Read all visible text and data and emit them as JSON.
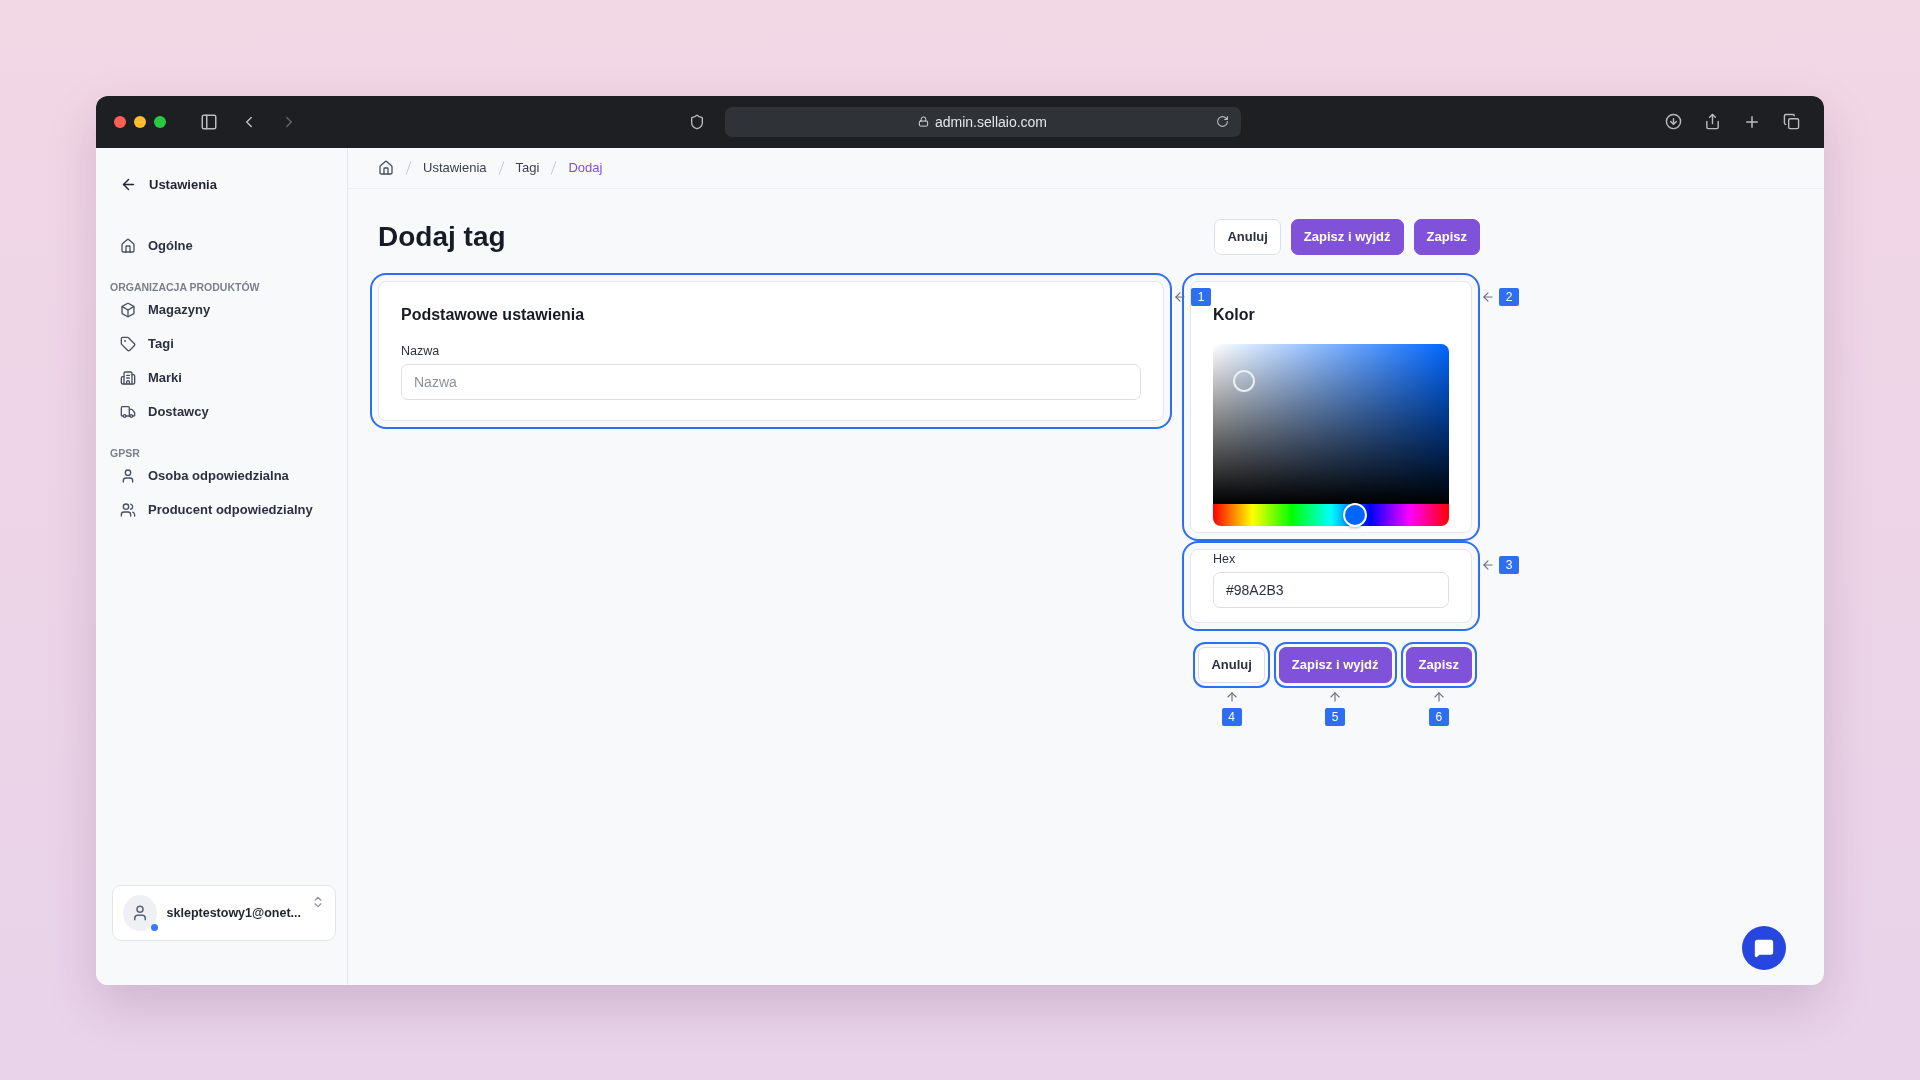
{
  "browser": {
    "url": "admin.sellaio.com"
  },
  "sidebar": {
    "back_label": "Ustawienia",
    "top_items": [
      {
        "label": "Ogólne"
      }
    ],
    "sections": [
      {
        "heading": "ORGANIZACJA PRODUKTÓW",
        "items": [
          {
            "label": "Magazyny"
          },
          {
            "label": "Tagi"
          },
          {
            "label": "Marki"
          },
          {
            "label": "Dostawcy"
          }
        ]
      },
      {
        "heading": "GPSR",
        "items": [
          {
            "label": "Osoba odpowiedzialna"
          },
          {
            "label": "Producent odpowiedzialny"
          }
        ]
      }
    ],
    "user": {
      "email": "skleptestowy1@onet...",
      "online": true
    }
  },
  "breadcrumb": [
    {
      "label": "Ustawienia",
      "selected": false
    },
    {
      "label": "Tagi",
      "selected": false
    },
    {
      "label": "Dodaj",
      "selected": true
    }
  ],
  "page": {
    "title": "Dodaj tag",
    "buttons": [
      {
        "label": "Anuluj",
        "kind": "secondary"
      },
      {
        "label": "Zapisz i wyjdź",
        "kind": "primary"
      },
      {
        "label": "Zapisz",
        "kind": "primary"
      }
    ]
  },
  "basic_card": {
    "title": "Podstawowe ustawienia",
    "field": {
      "label": "Nazwa",
      "placeholder": "Nazwa"
    },
    "marker": "1"
  },
  "color_card": {
    "title": "Kolor",
    "hue": {
      "level": 0.6
    },
    "marker": "2"
  },
  "hex_card": {
    "label": "Hex",
    "value": "#98A2B3",
    "marker": "3"
  },
  "bottom_buttons": [
    {
      "label": "Anuluj",
      "kind": "secondary",
      "marker": "4"
    },
    {
      "label": "Zapisz i wyjdź",
      "kind": "primary",
      "marker": "5"
    },
    {
      "label": "Zapisz",
      "kind": "primary",
      "marker": "6"
    }
  ]
}
